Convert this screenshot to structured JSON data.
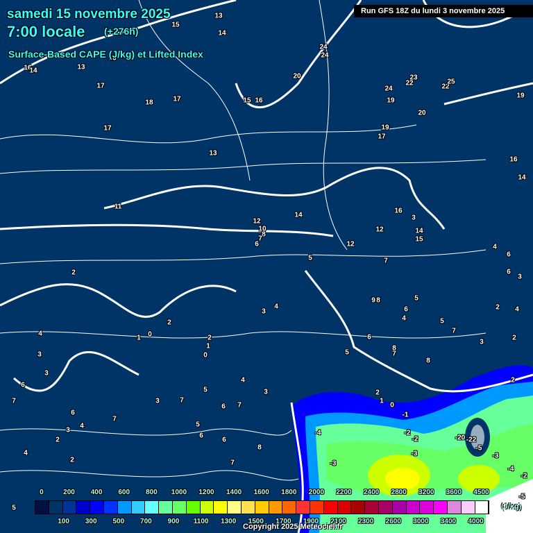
{
  "header": {
    "date": "samedi 15 novembre 2025",
    "time": "7:00 locale",
    "lead": "(+276h)",
    "parameter": "Surface-Based CAPE (J/kg) et Lifted Index",
    "run": "Run GFS 18Z du lundi 3 novembre 2025"
  },
  "colors": {
    "background": "#003366",
    "title": "#33ffff",
    "contour": "#ffffff"
  },
  "legend": {
    "unit": "(J/kg)",
    "top_labels": [
      "0",
      "200",
      "400",
      "600",
      "800",
      "1000",
      "1200",
      "1400",
      "1600",
      "1800",
      "2000",
      "2200",
      "2400",
      "2800",
      "3200",
      "3600",
      "4500"
    ],
    "bottom_labels": [
      "100",
      "300",
      "500",
      "700",
      "900",
      "1100",
      "1300",
      "1500",
      "1700",
      "1900",
      "2100",
      "2300",
      "2600",
      "3000",
      "3400",
      "4000"
    ],
    "swatches": [
      "#001040",
      "#003366",
      "#003399",
      "#0000cc",
      "#0000ff",
      "#0033ff",
      "#0099ff",
      "#33ccff",
      "#66ffff",
      "#66ff99",
      "#66ff66",
      "#66ff00",
      "#ccff00",
      "#ffff00",
      "#ffff88",
      "#ffe050",
      "#ffcc00",
      "#ff9900",
      "#ff6600",
      "#ff3333",
      "#ff3300",
      "#ff0000",
      "#dd0000",
      "#aa0000",
      "#aa0033",
      "#aa0066",
      "#aa00aa",
      "#cc00cc",
      "#dd00dd",
      "#ff00ff",
      "#dd88dd",
      "#ffccff",
      "#ffffff"
    ]
  },
  "lifted_index_labels": [
    "13",
    "14",
    "15",
    "16",
    "14",
    "13",
    "17",
    "16",
    "18",
    "17",
    "17",
    "15",
    "16",
    "13",
    "11",
    "12",
    "10",
    "8",
    "7",
    "6",
    "14",
    "20",
    "24",
    "24",
    "23",
    "22",
    "24",
    "22",
    "25",
    "19",
    "20",
    "19",
    "17",
    "19",
    "16",
    "14",
    "16",
    "3",
    "12",
    "14",
    "15",
    "12",
    "7",
    "5",
    "9",
    "8",
    "5",
    "6",
    "4",
    "4",
    "3",
    "2",
    "2",
    "0",
    "1",
    "2",
    "1",
    "0",
    "3",
    "4",
    "3",
    "6",
    "7",
    "6",
    "4",
    "3",
    "2",
    "2",
    "4",
    "5",
    "3",
    "7",
    "5",
    "7",
    "5",
    "6",
    "6",
    "7",
    "6",
    "8",
    "7",
    "4",
    "3",
    "5",
    "6",
    "8",
    "7",
    "8",
    "5",
    "7",
    "3",
    "2",
    "4",
    "2",
    "2",
    "6",
    "3",
    "6",
    "4",
    "2",
    "1",
    "0",
    "-1",
    "-4",
    "-2",
    "-2",
    "-3",
    "-3",
    "-20",
    "-22",
    "-5",
    "-3",
    "-4",
    "-2",
    "-5"
  ],
  "copyright": "Copyright 2025 Meteociel.fr"
}
